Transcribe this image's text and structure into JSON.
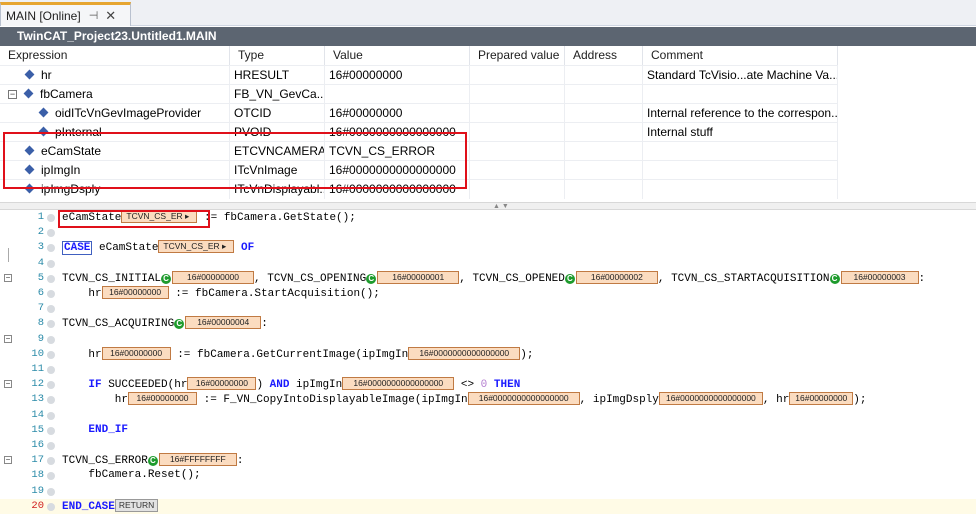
{
  "tab": {
    "label": "MAIN [Online]",
    "pin": "⊣",
    "close": "✕"
  },
  "title": "TwinCAT_Project23.Untitled1.MAIN",
  "watch": {
    "columns": [
      "Expression",
      "Type",
      "Value",
      "Prepared value",
      "Address",
      "Comment"
    ],
    "rows": [
      {
        "expr": "hr",
        "type": "HRESULT",
        "value": "16#00000000",
        "comment": "Standard  TcVisio...ate Machine Va..."
      },
      {
        "expr": "fbCamera",
        "type": "FB_VN_GevCa...",
        "value": "",
        "comment": "",
        "toggle": "−"
      },
      {
        "expr": "oidITcVnGevImageProvider",
        "type": "OTCID",
        "value": "16#00000000",
        "comment": "Internal reference to the correspon..."
      },
      {
        "expr": "pInternal",
        "type": "PVOID",
        "value": "16#0000000000000000",
        "comment": "Internal stuff"
      },
      {
        "expr": "eCamState",
        "type": "ETCVNCAMERA...",
        "value": "TCVN_CS_ERROR",
        "comment": ""
      },
      {
        "expr": "ipImgIn",
        "type": "ITcVnImage",
        "value": "16#0000000000000000",
        "comment": ""
      },
      {
        "expr": "ipImgDsply",
        "type": "ITcVnDisplayabl...",
        "value": "16#0000000000000000",
        "comment": ""
      }
    ]
  },
  "code": {
    "line_numbers": [
      "1",
      "2",
      "3",
      "4",
      "5",
      "6",
      "7",
      "8",
      "9",
      "10",
      "11",
      "12",
      "13",
      "14",
      "15",
      "16",
      "17",
      "18",
      "19",
      "20"
    ],
    "l1": {
      "a": "eCamState",
      "iv": "TCVN_CS_ER ▸",
      "b": " := fbCamera.GetState();"
    },
    "l3": {
      "kw1": "CASE",
      "a": " eCamState",
      "iv": "TCVN_CS_ER ▸",
      "kw2": "OF"
    },
    "l5": {
      "a": "TCVN_CS_INITIAL",
      "iv1": "16#00000000",
      "b": ", TCVN_CS_OPENING",
      "iv2": "16#00000001",
      "c": ", TCVN_CS_OPENED",
      "iv3": "16#00000002",
      "d": ", TCVN_CS_STARTACQUISITION",
      "iv4": "16#00000003",
      "e": ":"
    },
    "l6": {
      "a": "    hr",
      "iv": "16#00000000",
      "b": " := fbCamera.StartAcquisition();"
    },
    "l8": {
      "a": "TCVN_CS_ACQUIRING",
      "iv": "16#00000004",
      "b": ":"
    },
    "l10": {
      "a": "    hr",
      "iv1": "16#00000000",
      "b": " := fbCamera.GetCurrentImage(ipImgIn",
      "iv2": "16#0000000000000000",
      "c": ");"
    },
    "l12": {
      "kw1": "IF",
      "a": " SUCCEEDED(hr",
      "iv1": "16#00000000",
      "b": ") ",
      "kw2": "AND",
      "c": " ipImgIn",
      "iv2": "16#0000000000000000",
      "d": " <> ",
      "num": "0",
      "kw3": "THEN"
    },
    "l13": {
      "a": "        hr",
      "iv1": "16#00000000",
      "b": " := F_VN_CopyIntoDisplayableImage(ipImgIn",
      "iv2": "16#0000000000000000",
      "c": ", ipImgDsply",
      "iv3": "16#0000000000000000",
      "d": ", hr",
      "iv4": "16#00000000",
      "e": ");"
    },
    "l15": {
      "kw": "END_IF"
    },
    "l17": {
      "a": "TCVN_CS_ERROR",
      "iv": "16#FFFFFFFF",
      "b": ":"
    },
    "l18": {
      "a": "    fbCamera.Reset();"
    },
    "l20": {
      "kw": "END_CASE",
      "rt": "RETURN"
    },
    "gc": "C"
  },
  "colors": {
    "accent_tab": "#e6a530",
    "title_bg": "#5c6571",
    "highlight_box": "#e0101a",
    "inline_value_bg": "#fbdcc0",
    "keyword": "#1a1aff"
  }
}
